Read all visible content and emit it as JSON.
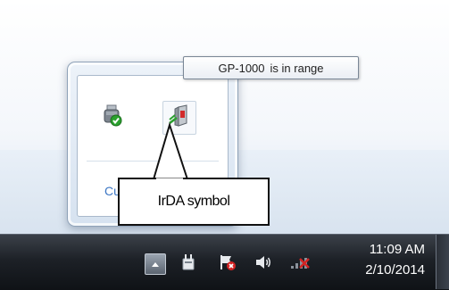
{
  "tooltip": {
    "device": "GP-1000",
    "status": "is in range"
  },
  "tray_popup": {
    "icons": [
      {
        "name": "usb-device-icon",
        "status": "check"
      },
      {
        "name": "irda-icon"
      }
    ],
    "customize_label": "Customize..."
  },
  "callout": {
    "label": "IrDA symbol"
  },
  "taskbar": {
    "tray_icons": [
      "show-hidden-icons-arrow",
      "power-icon",
      "action-center-icon",
      "volume-icon",
      "network-disconnected-icon"
    ],
    "clock": {
      "time": "11:09 AM",
      "date": "2/10/2014"
    }
  },
  "colors": {
    "taskbar": "#1d2127",
    "link": "#3c76c4",
    "check": "#2aa12e",
    "error": "#d32424"
  }
}
